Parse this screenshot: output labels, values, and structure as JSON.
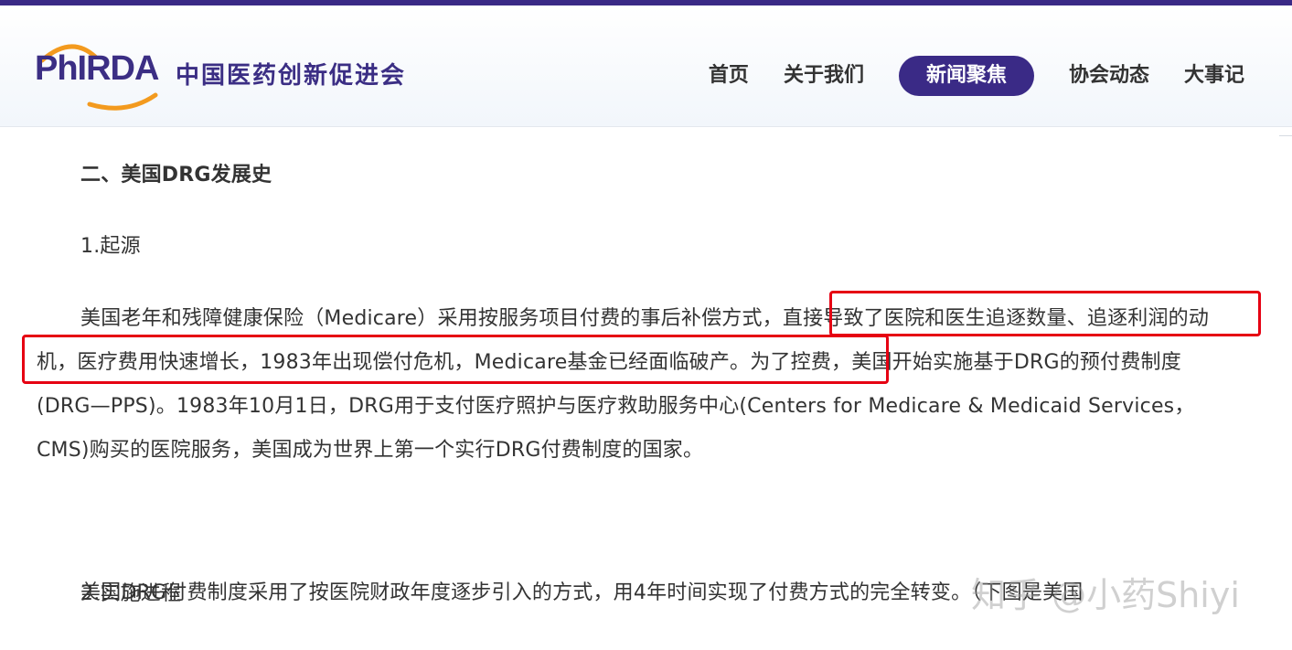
{
  "header": {
    "logo_text": "PhIRDA",
    "org_name": "中国医药创新促进会",
    "nav": [
      {
        "label": "首页",
        "active": false
      },
      {
        "label": "关于我们",
        "active": false
      },
      {
        "label": "新闻聚焦",
        "active": true
      },
      {
        "label": "协会动态",
        "active": false
      },
      {
        "label": "大事记",
        "active": false
      }
    ]
  },
  "article": {
    "section_title": "二、美国DRG发展史",
    "sub1": "1.起源",
    "para1": "美国老年和残障健康保险（Medicare）采用按服务项目付费的事后补偿方式，直接导致了医院和医生追逐数量、追逐利润的动机，医疗费用快速增长，1983年出现偿付危机，Medicare基金已经面临破产。为了控费，美国开始实施基于DRG的预付费制度(DRG—PPS)。1983年10月1日，DRG用于支付医疗照护与医疗救助服务中心(Centers for Medicare & Medicaid Services，CMS)购买的医院服务，美国成为世界上第一个实行DRG付费制度的国家。",
    "sub2": "2.实施进程",
    "para2": "美国DRG付费制度采用了按医院财政年度逐步引入的方式，用4年时间实现了付费方式的完全转变。（下图是美国"
  },
  "watermark": "知乎 @小药Shiyi",
  "colors": {
    "brand": "#3a2a86",
    "highlight_box": "#e60012",
    "logo_arc": "#f39a1e"
  }
}
